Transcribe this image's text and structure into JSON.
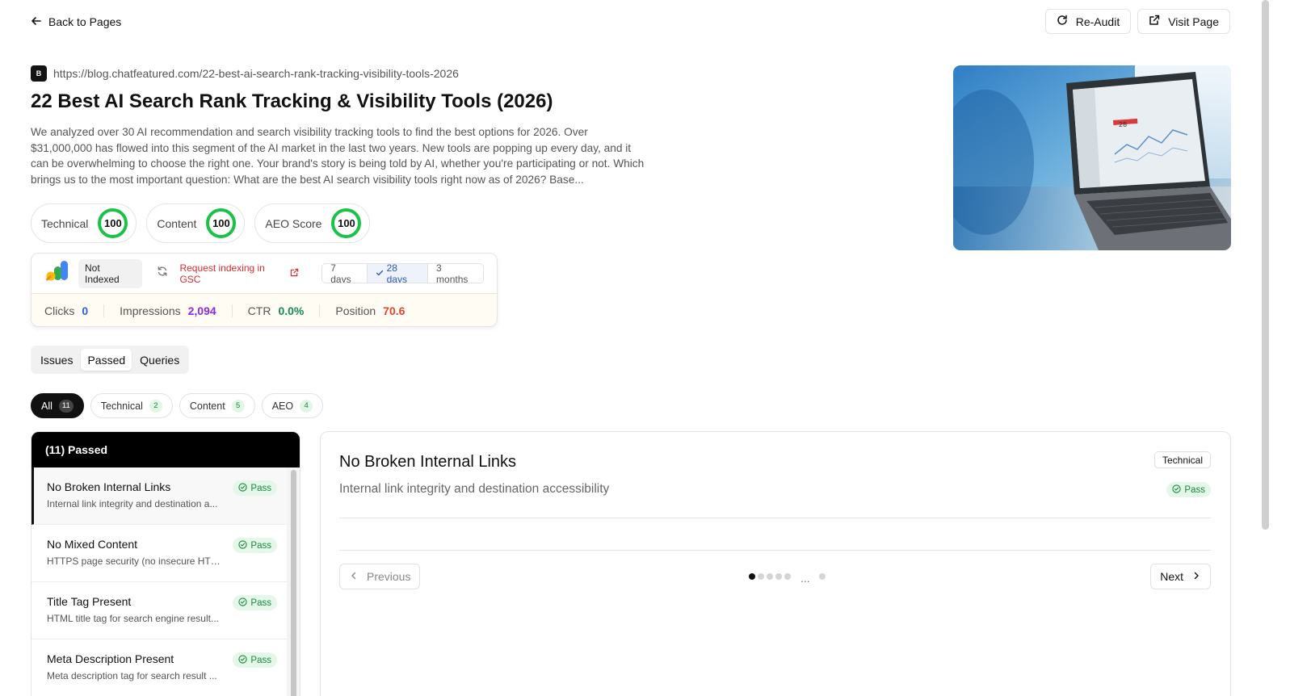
{
  "nav": {
    "back_label": "Back to Pages"
  },
  "actions": {
    "reaudit_label": "Re-Audit",
    "visit_label": "Visit Page"
  },
  "page": {
    "favicon_letter": "B",
    "url": "https://blog.chatfeatured.com/22-best-ai-search-rank-tracking-visibility-tools-2026",
    "title": "22 Best AI Search Rank Tracking & Visibility Tools (2026)",
    "description": "We analyzed over 30 AI recommendation and search visibility tracking tools to find the best options for 2026. Over $31,000,000 has flowed into this segment of the AI market in the last two years. New tools are popping up every day, and it can be overwhelming to choose the right one. Your brand's story is being told by AI, whether you're participating or not. Which brings us to the most important question: What are the best AI search visibility tools right now as of 2026? Base..."
  },
  "scores": [
    {
      "label": "Technical",
      "value": "100"
    },
    {
      "label": "Content",
      "value": "100"
    },
    {
      "label": "AEO Score",
      "value": "100"
    }
  ],
  "gsc": {
    "index_status": "Not Indexed",
    "request_label": "Request indexing in GSC",
    "ranges": [
      "7 days",
      "28 days",
      "3 months"
    ],
    "selected_range": "28 days",
    "metrics": [
      {
        "label": "Clicks",
        "value": "0",
        "color": "#2f5fd8"
      },
      {
        "label": "Impressions",
        "value": "2,094",
        "color": "#8a2be2"
      },
      {
        "label": "CTR",
        "value": "0.0%",
        "color": "#138a58"
      },
      {
        "label": "Position",
        "value": "70.6",
        "color": "#e0452f"
      }
    ]
  },
  "tabs": [
    "Issues",
    "Passed",
    "Queries"
  ],
  "active_tab": "Passed",
  "filters": [
    {
      "label": "All",
      "count": "11"
    },
    {
      "label": "Technical",
      "count": "2"
    },
    {
      "label": "Content",
      "count": "5"
    },
    {
      "label": "AEO",
      "count": "4"
    }
  ],
  "passed": {
    "header": "(11) Passed",
    "pass_label": "Pass",
    "items": [
      {
        "title": "No Broken Internal Links",
        "desc": "Internal link integrity and destination a..."
      },
      {
        "title": "No Mixed Content",
        "desc": "HTTPS page security (no insecure HTT..."
      },
      {
        "title": "Title Tag Present",
        "desc": "HTML title tag for search engine result..."
      },
      {
        "title": "Meta Description Present",
        "desc": "Meta description tag for search result ..."
      }
    ]
  },
  "detail": {
    "title": "No Broken Internal Links",
    "subtitle": "Internal link integrity and destination accessibility",
    "category": "Technical",
    "status": "Pass",
    "prev_label": "Previous",
    "next_label": "Next",
    "ellipsis": "..."
  },
  "colors": {
    "score_ring": "#1bc24a",
    "pass_green": "#168a3b",
    "accent_red": "#d92d2d"
  },
  "icons": [
    "arrow-left-icon",
    "refresh-icon",
    "external-link-icon",
    "gsc-logo-icon",
    "check-icon",
    "check-circle-icon",
    "chevron-left-icon",
    "chevron-right-icon"
  ]
}
